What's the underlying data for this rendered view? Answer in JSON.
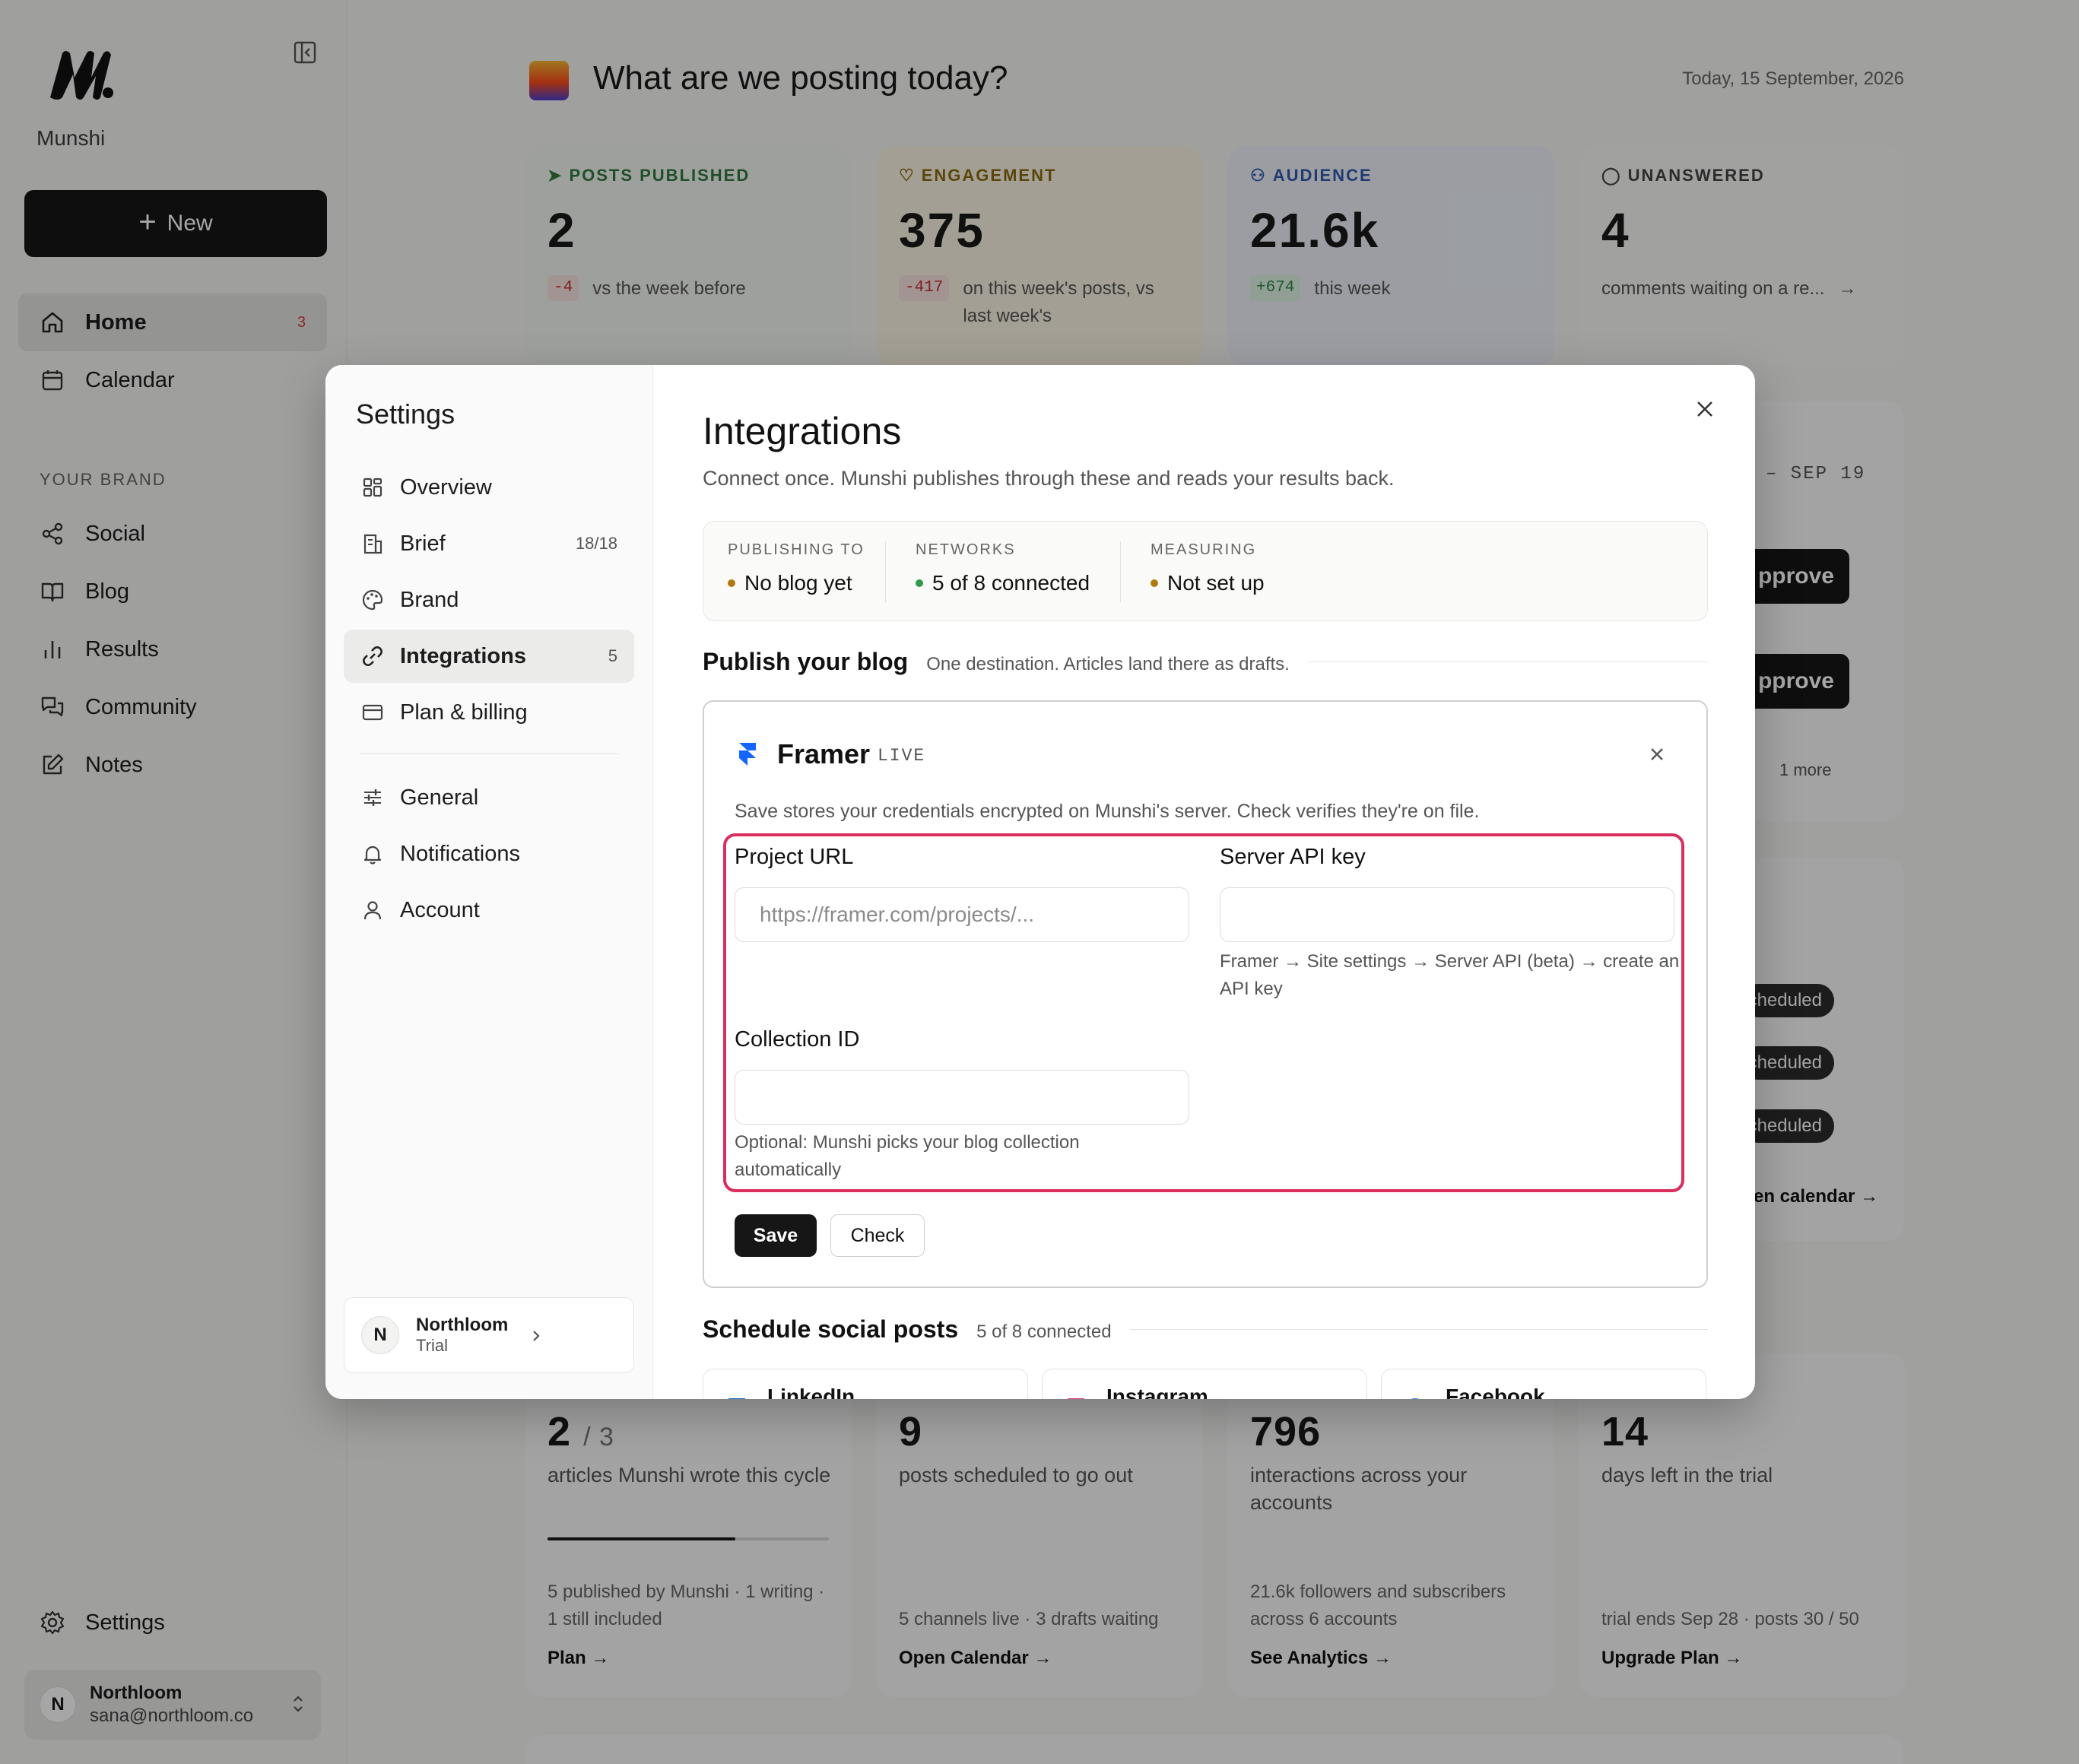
{
  "sidebar": {
    "brand_name": "Munshi",
    "new_label": "New",
    "nav": [
      {
        "label": "Home",
        "badge": "3"
      },
      {
        "label": "Calendar"
      }
    ],
    "section_label": "YOUR BRAND",
    "brand_nav": [
      {
        "label": "Social"
      },
      {
        "label": "Blog"
      },
      {
        "label": "Results"
      },
      {
        "label": "Community"
      },
      {
        "label": "Notes"
      }
    ],
    "settings_label": "Settings",
    "user": {
      "initial": "N",
      "name": "Northloom",
      "email": "sana@northloom.co"
    }
  },
  "main": {
    "title": "What are we posting today?",
    "date": "Today, 15 September, 2026",
    "stats": [
      {
        "label": "POSTS PUBLISHED",
        "value": "2",
        "delta": "-4",
        "sub": "vs the week before",
        "color": "#2f7a3e"
      },
      {
        "label": "ENGAGEMENT",
        "value": "375",
        "delta": "-417",
        "sub": "on this week's posts, vs last week's",
        "color": "#8a6a10"
      },
      {
        "label": "AUDIENCE",
        "value": "21.6k",
        "delta": "+674",
        "sub": "this week",
        "color": "#2f5cae"
      },
      {
        "label": "UNANSWERED",
        "value": "4",
        "sub": "comments waiting on a re...",
        "color": "#444444"
      }
    ],
    "week_range": "– SEP 19",
    "approve_label": "pprove",
    "more_label": "1 more",
    "scheduled_label": "Scheduled",
    "calendar_link": "en calendar →",
    "bottom": [
      {
        "value": "2",
        "value_small": "/ 3",
        "desc": "articles Munshi wrote this cycle",
        "meta": "5 published by Munshi · 1 writing · 1 still included",
        "link": "Plan →",
        "progress": 0.667
      },
      {
        "value": "9",
        "desc": "posts scheduled to go out",
        "meta": "5 channels live · 3 drafts waiting",
        "link": "Open Calendar →"
      },
      {
        "value": "796",
        "desc": "interactions across your accounts",
        "meta": "21.6k followers and subscribers across 6 accounts",
        "link": "See Analytics →"
      },
      {
        "value": "14",
        "desc": "days left in the trial",
        "meta": "trial ends Sep 28 · posts 30 / 50",
        "link": "Upgrade Plan →"
      }
    ]
  },
  "settings": {
    "title": "Settings",
    "nav": [
      {
        "label": "Overview"
      },
      {
        "label": "Brief",
        "count": "18/18"
      },
      {
        "label": "Brand"
      },
      {
        "label": "Integrations",
        "count": "5"
      },
      {
        "label": "Plan & billing"
      }
    ],
    "nav2": [
      {
        "label": "General"
      },
      {
        "label": "Notifications"
      },
      {
        "label": "Account"
      }
    ],
    "org": {
      "initial": "N",
      "name": "Northloom",
      "plan": "Trial"
    }
  },
  "integrations": {
    "title": "Integrations",
    "subtitle": "Connect once. Munshi publishes through these and reads your results back.",
    "status": [
      {
        "key": "PUBLISHING TO",
        "value": "No blog yet",
        "dot": "#b07a12"
      },
      {
        "key": "NETWORKS",
        "value": "5 of 8 connected",
        "dot": "#2f9a4a"
      },
      {
        "key": "MEASURING",
        "value": "Not set up",
        "dot": "#b07a12"
      }
    ],
    "blog_heading": "Publish your blog",
    "blog_desc": "One destination. Articles land there as drafts.",
    "framer": {
      "name": "Framer",
      "status": "LIVE",
      "note": "Save stores your credentials encrypted on Munshi's server. Check verifies they're on file.",
      "project_url_label": "Project URL",
      "project_url_placeholder": "https://framer.com/projects/...",
      "api_key_label": "Server API key",
      "api_key_help": "Framer → Site settings → Server API (beta) → create an API key",
      "collection_label": "Collection ID",
      "collection_help": "Optional: Munshi picks your blog collection automatically",
      "save_label": "Save",
      "check_label": "Check"
    },
    "social_heading": "Schedule social posts",
    "social_desc": "5 of 8 connected",
    "social_cards": [
      {
        "name": "LinkedIn",
        "color": "#0a66c2"
      },
      {
        "name": "Instagram",
        "color": "#e1306c"
      },
      {
        "name": "Facebook",
        "color": "#1877f2"
      }
    ]
  }
}
